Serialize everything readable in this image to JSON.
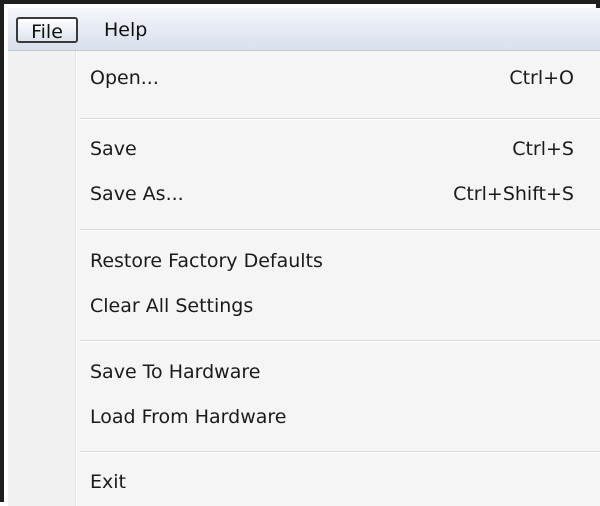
{
  "menubar": {
    "file_label": "File",
    "help_label": "Help"
  },
  "menu": {
    "items": [
      {
        "label": "Open...",
        "shortcut": "Ctrl+O"
      },
      {
        "label": "Save",
        "shortcut": "Ctrl+S"
      },
      {
        "label": "Save As...",
        "shortcut": "Ctrl+Shift+S"
      },
      {
        "label": "Restore Factory Defaults",
        "shortcut": ""
      },
      {
        "label": "Clear All Settings",
        "shortcut": ""
      },
      {
        "label": "Save To Hardware",
        "shortcut": ""
      },
      {
        "label": "Load From Hardware",
        "shortcut": ""
      },
      {
        "label": "Exit",
        "shortcut": ""
      }
    ]
  },
  "colors": {
    "menubar_top": "#f6f7fb",
    "menubar_bottom": "#d9e0ec",
    "menu_background": "#f5f5f5",
    "frame_border": "#1e1e1e"
  }
}
